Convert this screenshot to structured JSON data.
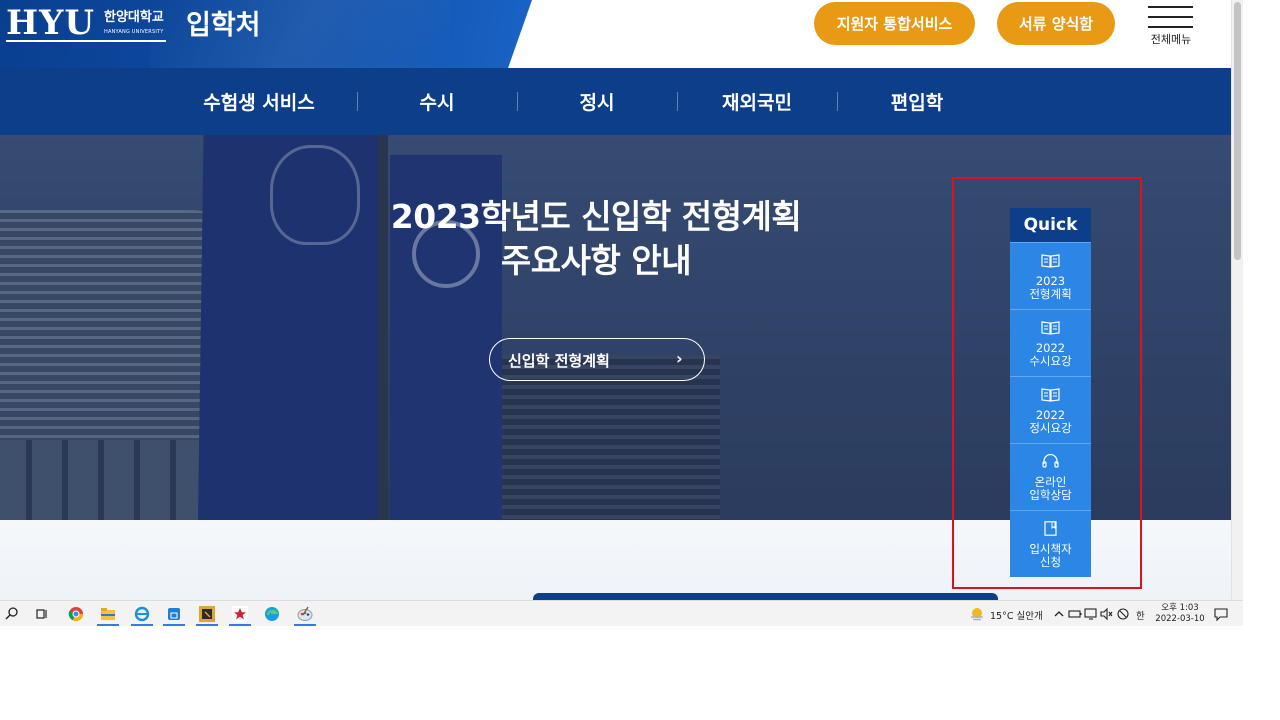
{
  "header": {
    "logo_text": "HYU",
    "logo_kr": "한양대학교",
    "logo_en": "HANYANG UNIVERSITY",
    "title": "입학처",
    "buttons": [
      {
        "label": "지원자 통합서비스"
      },
      {
        "label": "서류 양식함"
      }
    ],
    "menu_label": "전체메뉴",
    "accent_color": "#e99a15",
    "brand_color": "#0d3e8a"
  },
  "nav": {
    "items": [
      {
        "label": "수험생 서비스"
      },
      {
        "label": "수시"
      },
      {
        "label": "정시"
      },
      {
        "label": "재외국민"
      },
      {
        "label": "편입학"
      }
    ]
  },
  "hero": {
    "title_line1": "2023학년도 신입학 전형계획",
    "title_line2": "주요사항 안내",
    "button_label": "신입학 전형계획",
    "chevron": "›"
  },
  "quick": {
    "title": "Quick",
    "items": [
      {
        "icon": "book-icon",
        "line1": "2023",
        "line2": "전형계획"
      },
      {
        "icon": "book-icon",
        "line1": "2022",
        "line2": "수시요강"
      },
      {
        "icon": "book-icon",
        "line1": "2022",
        "line2": "정시요강"
      },
      {
        "icon": "headset-icon",
        "line1": "온라인",
        "line2": "입학상담"
      },
      {
        "icon": "booklet-icon",
        "line1": "입시책자",
        "line2": "신청"
      }
    ],
    "item_color": "#2c86e6"
  },
  "taskbar": {
    "weather": "15°C  실안개",
    "ime": "한",
    "time": "오후 1:03",
    "date": "2022-03-10"
  }
}
